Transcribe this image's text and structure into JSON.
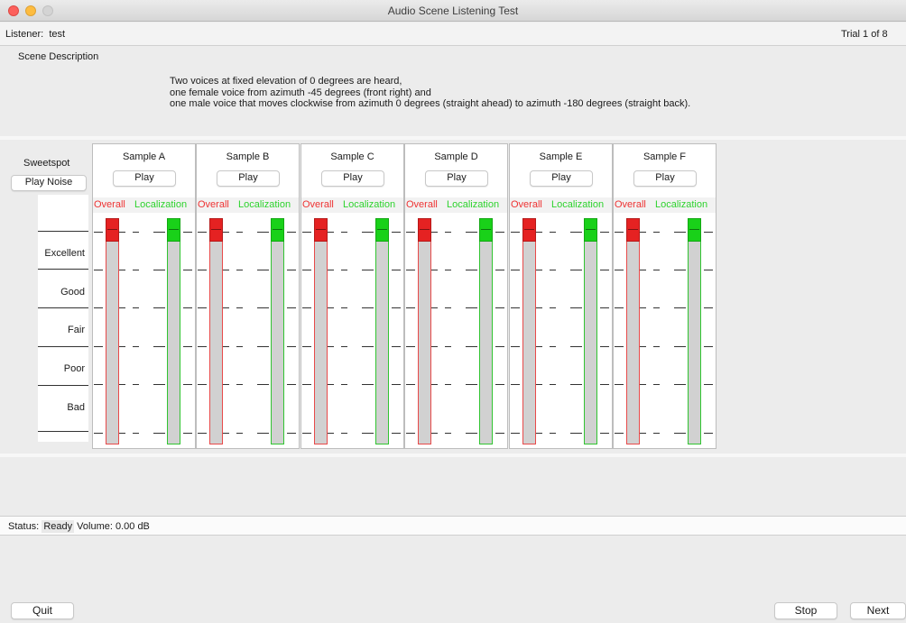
{
  "window": {
    "title": "Audio Scene Listening Test"
  },
  "header": {
    "listener_label": "Listener:",
    "listener_name": "test",
    "trial_label": "Trial 1 of 8"
  },
  "scene": {
    "label": "Scene Description",
    "lines": [
      "Two voices at fixed elevation of 0 degrees are heard,",
      "one female voice from azimuth -45 degrees (front right) and",
      "one male voice that moves clockwise from azimuth 0 degrees (straight ahead) to azimuth -180 degrees (straight back)."
    ]
  },
  "sidebar": {
    "sweetspot_label": "Sweetspot",
    "play_noise_label": "Play Noise",
    "scale": [
      "Excellent",
      "Good",
      "Fair",
      "Poor",
      "Bad"
    ]
  },
  "samples": [
    {
      "title": "Sample A",
      "play_label": "Play",
      "overall_label": "Overall",
      "localization_label": "Localization",
      "overall_value": 100,
      "localization_value": 100
    },
    {
      "title": "Sample B",
      "play_label": "Play",
      "overall_label": "Overall",
      "localization_label": "Localization",
      "overall_value": 100,
      "localization_value": 100
    },
    {
      "title": "Sample C",
      "play_label": "Play",
      "overall_label": "Overall",
      "localization_label": "Localization",
      "overall_value": 100,
      "localization_value": 100
    },
    {
      "title": "Sample D",
      "play_label": "Play",
      "overall_label": "Overall",
      "localization_label": "Localization",
      "overall_value": 100,
      "localization_value": 100
    },
    {
      "title": "Sample E",
      "play_label": "Play",
      "overall_label": "Overall",
      "localization_label": "Localization",
      "overall_value": 100,
      "localization_value": 100
    },
    {
      "title": "Sample F",
      "play_label": "Play",
      "overall_label": "Overall",
      "localization_label": "Localization",
      "overall_value": 100,
      "localization_value": 100
    }
  ],
  "status": {
    "label": "Status:",
    "state": "Ready",
    "volume_text": "Volume: 0.00 dB"
  },
  "buttons": {
    "quit": "Quit",
    "stop": "Stop",
    "next": "Next"
  },
  "colors": {
    "overall": "#ee3333",
    "localization": "#2ed32e",
    "overall_handle": "#e52222",
    "localization_handle": "#19d119"
  }
}
